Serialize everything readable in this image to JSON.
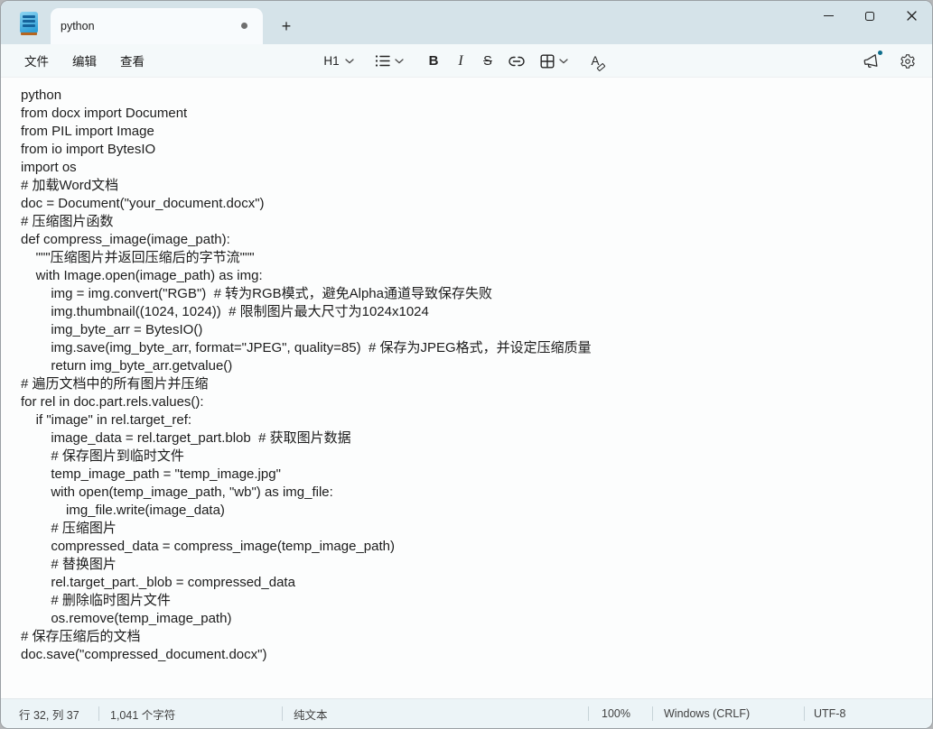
{
  "titlebar": {
    "tab_title": "python",
    "new_tab_button": "+"
  },
  "menubar": {
    "items": [
      {
        "label": "文件"
      },
      {
        "label": "编辑"
      },
      {
        "label": "查看"
      }
    ]
  },
  "toolbar": {
    "heading": "H1",
    "bold": "B",
    "italic": "I",
    "strikethrough": "S",
    "clear_format": "A"
  },
  "icons": {
    "app": "notepad-icon",
    "unsaved": "unsaved-dot-icon",
    "heading_chevron": "chevron-down-icon",
    "list": "bullet-list-icon",
    "link": "link-icon",
    "table": "table-grid-icon",
    "announce": "megaphone-icon",
    "settings": "gear-icon",
    "minimize": "minimize-icon",
    "maximize": "maximize-icon",
    "close": "close-icon"
  },
  "editor": {
    "lines": [
      "python",
      "from docx import Document",
      "from PIL import Image",
      "from io import BytesIO",
      "import os",
      "# 加载Word文档",
      "doc = Document(\"your_document.docx\")",
      "# 压缩图片函数",
      "def compress_image(image_path):",
      "    \"\"\"压缩图片并返回压缩后的字节流\"\"\"",
      "    with Image.open(image_path) as img:",
      "        img = img.convert(\"RGB\")  # 转为RGB模式，避免Alpha通道导致保存失败",
      "        img.thumbnail((1024, 1024))  # 限制图片最大尺寸为1024x1024",
      "        img_byte_arr = BytesIO()",
      "        img.save(img_byte_arr, format=\"JPEG\", quality=85)  # 保存为JPEG格式，并设定压缩质量",
      "        return img_byte_arr.getvalue()",
      "# 遍历文档中的所有图片并压缩",
      "for rel in doc.part.rels.values():",
      "    if \"image\" in rel.target_ref:",
      "        image_data = rel.target_part.blob  # 获取图片数据",
      "        # 保存图片到临时文件",
      "        temp_image_path = \"temp_image.jpg\"",
      "        with open(temp_image_path, \"wb\") as img_file:",
      "            img_file.write(image_data)",
      "        # 压缩图片",
      "        compressed_data = compress_image(temp_image_path)",
      "        # 替换图片",
      "        rel.target_part._blob = compressed_data",
      "        # 删除临时图片文件",
      "        os.remove(temp_image_path)",
      "# 保存压缩后的文档",
      "doc.save(\"compressed_document.docx\")"
    ]
  },
  "statusbar": {
    "cursor": "行 32, 列 37",
    "chars": "1,041 个字符",
    "doc_type": "纯文本",
    "zoom": "100%",
    "eol": "Windows (CRLF)",
    "encoding": "UTF-8"
  },
  "colors": {
    "titlebar_bg": "#d5e3e9",
    "tab_bg": "#f8fbfd",
    "toolbar_bg": "#f4f9fa",
    "editor_bg": "#fcfdfd",
    "statusbar_bg": "#ecf4f7",
    "notification_dot": "#0e6e8c",
    "text": "#1c1c1c"
  }
}
